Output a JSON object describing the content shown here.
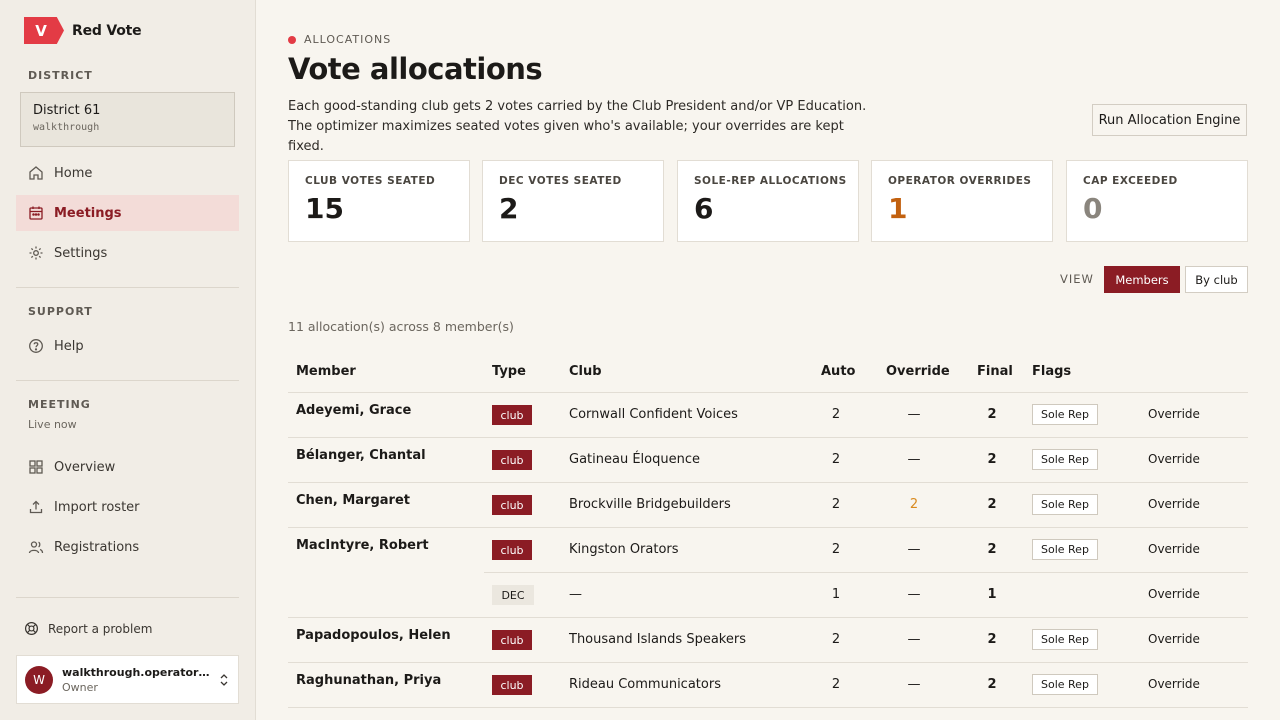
{
  "app": {
    "logo_letter": "V",
    "name": "Red Vote"
  },
  "sidebar": {
    "district_label": "DISTRICT",
    "district_name": "District 61",
    "district_sub": "walkthrough",
    "nav": [
      {
        "label": "Home",
        "icon": "home-icon"
      },
      {
        "label": "Meetings",
        "icon": "calendar-icon"
      },
      {
        "label": "Settings",
        "icon": "gear-icon"
      }
    ],
    "support_label": "SUPPORT",
    "support_nav": [
      {
        "label": "Help",
        "icon": "help-icon"
      }
    ],
    "meeting_label": "MEETING",
    "meeting_status": "Live now",
    "meeting_nav": [
      {
        "label": "Overview",
        "icon": "grid-icon"
      },
      {
        "label": "Import roster",
        "icon": "upload-icon"
      },
      {
        "label": "Registrations",
        "icon": "users-icon"
      }
    ],
    "report_label": "Report a problem",
    "user": {
      "initial": "W",
      "email": "walkthrough.operator@ta...",
      "role": "Owner"
    }
  },
  "header": {
    "eyebrow": "ALLOCATIONS",
    "title": "Vote allocations",
    "description": "Each good-standing club gets 2 votes carried by the Club President and/or VP Education. The optimizer maximizes seated votes given who's available; your overrides are kept fixed.",
    "run_button": "Run Allocation Engine"
  },
  "stats": [
    {
      "label": "CLUB VOTES SEATED",
      "value": "15",
      "color": "#1c1a18"
    },
    {
      "label": "DEC VOTES SEATED",
      "value": "2",
      "color": "#1c1a18"
    },
    {
      "label": "SOLE-REP ALLOCATIONS",
      "value": "6",
      "color": "#1c1a18"
    },
    {
      "label": "OPERATOR OVERRIDES",
      "value": "1",
      "color": "#c2610f"
    },
    {
      "label": "CAP EXCEEDED",
      "value": "0",
      "color": "#8a857d"
    }
  ],
  "view": {
    "label": "VIEW",
    "members": "Members",
    "by_club": "By club"
  },
  "summary": "11 allocation(s) across 8 member(s)",
  "table": {
    "headers": {
      "member": "Member",
      "type": "Type",
      "club": "Club",
      "auto": "Auto",
      "override": "Override",
      "final": "Final",
      "flags": "Flags"
    },
    "rows": [
      {
        "member": "Adeyemi, Grace",
        "type": "club",
        "club": "Cornwall Confident Voices",
        "auto": "2",
        "override": "—",
        "final": "2",
        "flag": "Sole Rep",
        "action": "Override"
      },
      {
        "member": "Bélanger, Chantal",
        "type": "club",
        "club": "Gatineau Éloquence",
        "auto": "2",
        "override": "—",
        "final": "2",
        "flag": "Sole Rep",
        "action": "Override"
      },
      {
        "member": "Chen, Margaret",
        "type": "club",
        "club": "Brockville Bridgebuilders",
        "auto": "2",
        "override": "2",
        "final": "2",
        "flag": "Sole Rep",
        "action": "Override"
      },
      {
        "member": "MacIntyre, Robert",
        "type": "club",
        "club": "Kingston Orators",
        "auto": "2",
        "override": "—",
        "final": "2",
        "flag": "Sole Rep",
        "action": "Override"
      },
      {
        "member": "",
        "type": "DEC",
        "club": "—",
        "auto": "1",
        "override": "—",
        "final": "1",
        "flag": "",
        "action": "Override"
      },
      {
        "member": "Papadopoulos, Helen",
        "type": "club",
        "club": "Thousand Islands Speakers",
        "auto": "2",
        "override": "—",
        "final": "2",
        "flag": "Sole Rep",
        "action": "Override"
      },
      {
        "member": "Raghunathan, Priya",
        "type": "club",
        "club": "Rideau Communicators",
        "auto": "2",
        "override": "—",
        "final": "2",
        "flag": "Sole Rep",
        "action": "Override"
      }
    ]
  }
}
